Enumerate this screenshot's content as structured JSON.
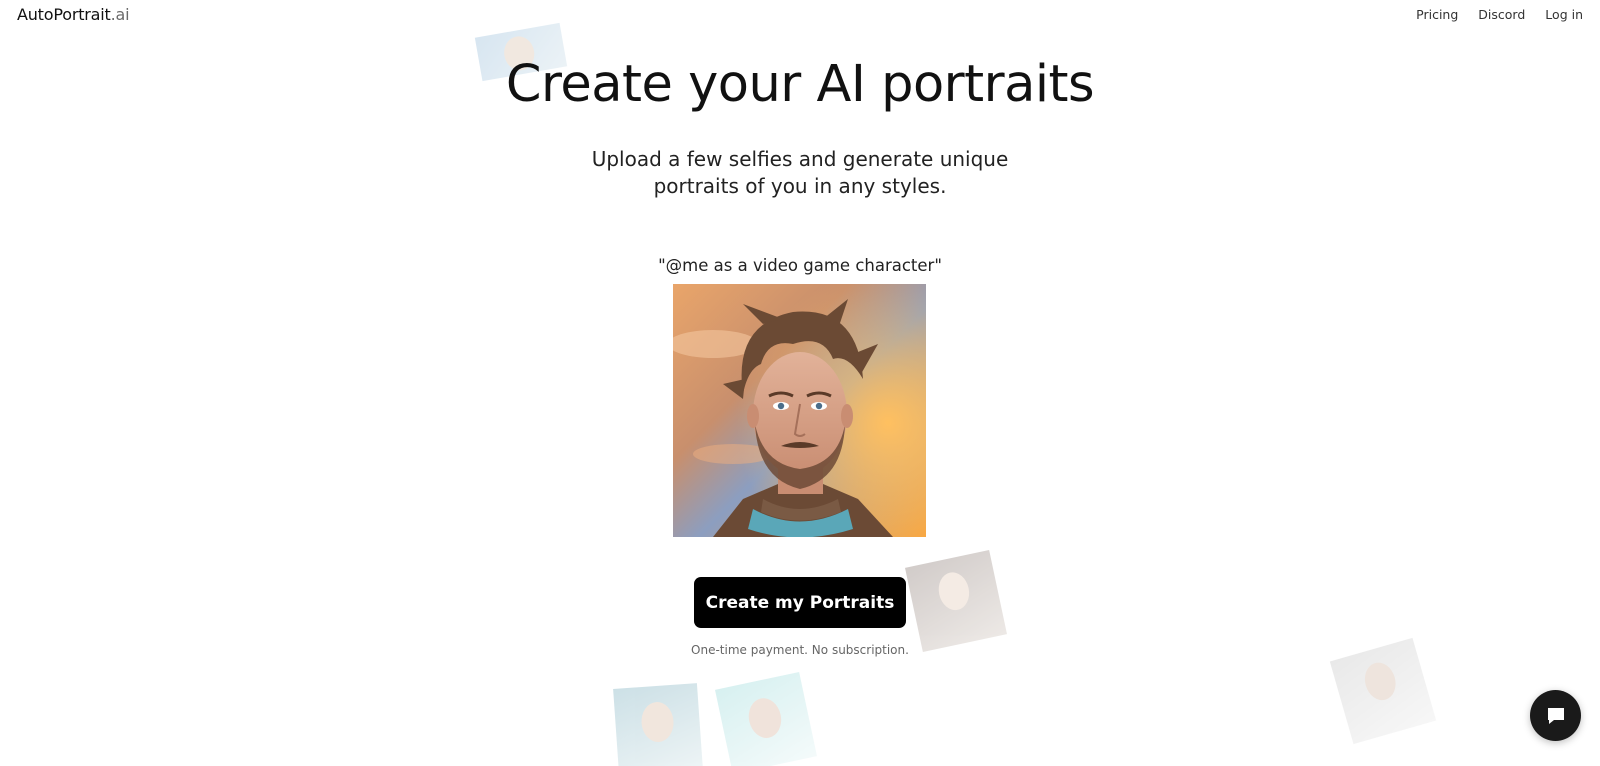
{
  "header": {
    "logo_brand": "AutoPortrait",
    "logo_tld": ".ai",
    "nav": [
      {
        "label": "Pricing"
      },
      {
        "label": "Discord"
      },
      {
        "label": "Log in"
      }
    ]
  },
  "hero": {
    "title": "Create your AI portraits",
    "subtitle": "Upload a few selfies and generate unique portraits of you in any styles."
  },
  "example": {
    "prompt": "\"@me as a video game character\""
  },
  "cta": {
    "button_label": "Create my Portraits",
    "note": "One-time payment. No subscription."
  },
  "chat": {
    "icon": "chat-bubble-icon"
  },
  "colors": {
    "primary": "#000000",
    "background": "#ffffff",
    "text": "#111111",
    "muted": "#666666"
  }
}
